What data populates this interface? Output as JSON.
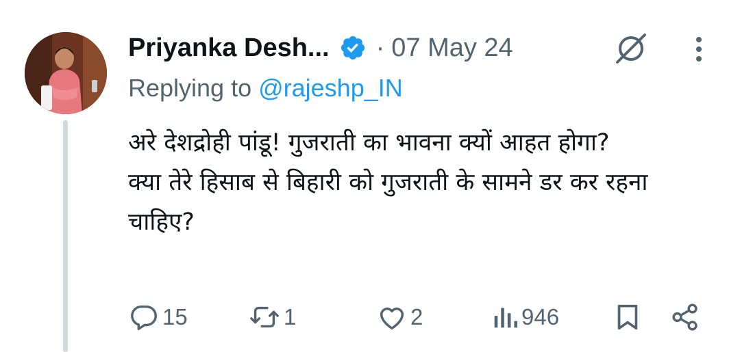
{
  "tweet": {
    "author": {
      "display_name": "Priyanka Desh...",
      "verified_icon": "verified-badge-icon"
    },
    "separator": "·",
    "date": "07 May 24",
    "replying_prefix": "Replying to ",
    "replying_handle": "@rajeshp_IN",
    "text_lines": [
      "अरे देशद्रोही पांडू! गुजराती का भावना क्यों आहत होगा?",
      "क्या तेरे हिसाब से बिहारी को गुजराती के सामने डर कर रहना चाहिए?"
    ],
    "actions": {
      "replies": "15",
      "retweets": "1",
      "likes": "2",
      "views": "946"
    }
  },
  "colors": {
    "text_primary": "#0f1419",
    "text_secondary": "#536471",
    "accent_blue": "#1d9bf0",
    "thread_line": "#cfd9de"
  },
  "icons": [
    "grok-icon",
    "more-vertical-icon",
    "reply-icon",
    "retweet-icon",
    "like-icon",
    "views-icon",
    "bookmark-icon",
    "share-icon"
  ]
}
